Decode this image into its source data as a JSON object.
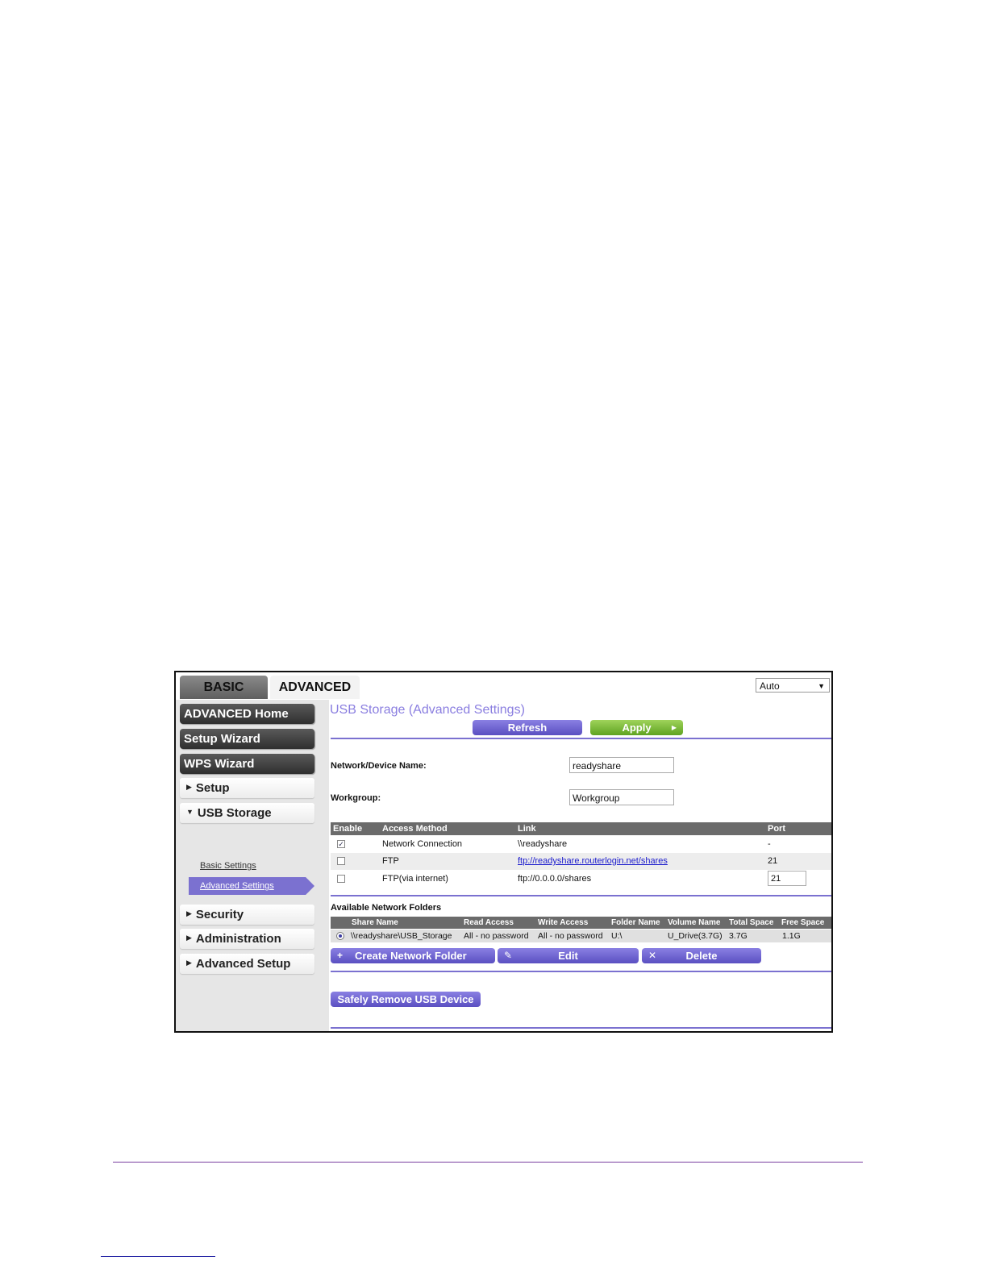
{
  "tabs": {
    "basic": "BASIC",
    "advanced": "ADVANCED"
  },
  "language_select": {
    "value": "Auto"
  },
  "sidebar": {
    "advanced_home": "ADVANCED Home",
    "setup_wizard": "Setup Wizard",
    "wps_wizard": "WPS Wizard",
    "setup": "Setup",
    "usb_storage": "USB Storage",
    "basic_settings": "Basic Settings",
    "advanced_settings": "Advanced Settings",
    "security": "Security",
    "administration": "Administration",
    "advanced_setup": "Advanced Setup"
  },
  "main": {
    "title": "USB Storage (Advanced Settings)",
    "refresh": "Refresh",
    "apply": "Apply",
    "device_name_label": "Network/Device Name:",
    "device_name_value": "readyshare",
    "workgroup_label": "Workgroup:",
    "workgroup_value": "Workgroup",
    "access_table": {
      "headers": [
        "Enable",
        "Access Method",
        "Link",
        "Port"
      ],
      "rows": [
        {
          "enabled": true,
          "method": "Network Connection",
          "link": "\\\\readyshare",
          "port": "-"
        },
        {
          "enabled": false,
          "method": "FTP",
          "link": "ftp://readyshare.routerlogin.net/shares",
          "port": "21"
        },
        {
          "enabled": false,
          "method": "FTP(via internet)",
          "link": "ftp://0.0.0.0/shares",
          "port": "21"
        }
      ]
    },
    "folders_title": "Available Network Folders",
    "folders_table": {
      "headers": [
        "Share Name",
        "Read Access",
        "Write Access",
        "Folder Name",
        "Volume Name",
        "Total Space",
        "Free Space"
      ],
      "rows": [
        {
          "share": "\\\\readyshare\\USB_Storage",
          "read": "All - no password",
          "write": "All - no password",
          "folder": "U:\\",
          "volume": "U_Drive(3.7G)",
          "total": "3.7G",
          "free": "1.1G"
        }
      ]
    },
    "create_folder": "Create Network Folder",
    "edit": "Edit",
    "delete": "Delete",
    "safely_remove": "Safely Remove USB Device"
  },
  "colors": {
    "accent": "#7b71d0",
    "apply_green": "#7cbf3a",
    "header_gray": "#6b6b6b"
  }
}
